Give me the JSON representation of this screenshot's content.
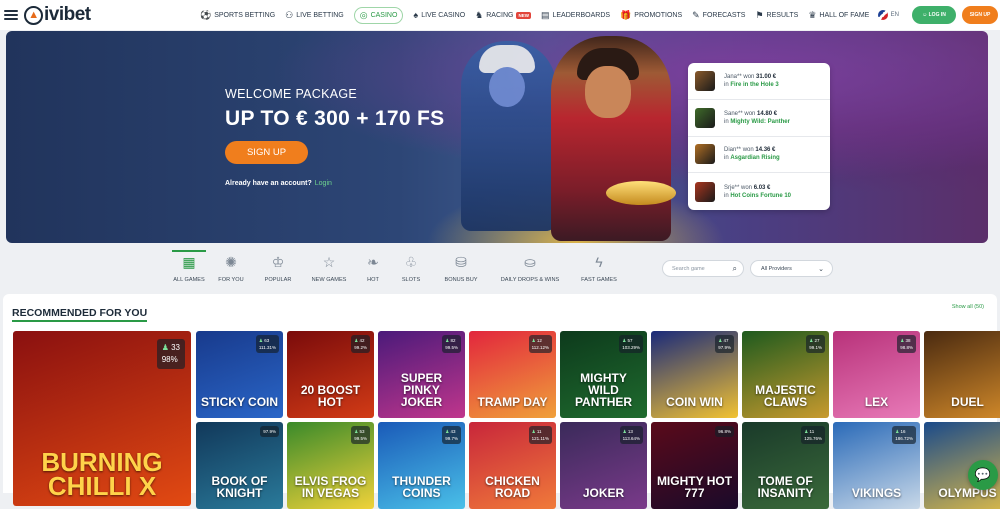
{
  "brand": {
    "name": "ivibet"
  },
  "nav": {
    "items": [
      {
        "label": "SPORTS BETTING",
        "icon": "soccer-ball-icon"
      },
      {
        "label": "LIVE BETTING",
        "icon": "live-icon"
      },
      {
        "label": "CASINO",
        "icon": "casino-chip-icon",
        "active": true
      },
      {
        "label": "LIVE CASINO",
        "icon": "card-icon"
      },
      {
        "label": "RACING",
        "icon": "horse-icon",
        "badge": "NEW"
      },
      {
        "label": "LEADERBOARDS",
        "icon": "leaderboard-icon"
      },
      {
        "label": "PROMOTIONS",
        "icon": "gift-icon"
      },
      {
        "label": "FORECASTS",
        "icon": "forecast-icon"
      },
      {
        "label": "RESULTS",
        "icon": "results-icon"
      },
      {
        "label": "HALL OF FAME",
        "icon": "trophy-icon"
      }
    ],
    "lang": "EN",
    "login_label": "LOG IN",
    "signup_label": "SIGN UP"
  },
  "hero": {
    "subtitle": "WELCOME PACKAGE",
    "headline": "UP TO € 300 + 170 FS",
    "cta": "SIGN UP",
    "account_text": "Already have an account?",
    "login_link": "Login"
  },
  "winners": [
    {
      "name": "Jana**",
      "won_text": "won",
      "amount": "31.00 €",
      "in_text": "in",
      "game": "Fire in the Hole 3",
      "color": "#8a5a2b"
    },
    {
      "name": "Sane**",
      "won_text": "won",
      "amount": "14.80 €",
      "in_text": "in",
      "game": "Mighty Wild: Panther",
      "color": "#3f6b2a"
    },
    {
      "name": "Dian**",
      "won_text": "won",
      "amount": "14.36 €",
      "in_text": "in",
      "game": "Asgardian Rising",
      "color": "#b06f25"
    },
    {
      "name": "Srje**",
      "won_text": "won",
      "amount": "6.03 €",
      "in_text": "in",
      "game": "Hot Coins Fortune 10",
      "color": "#a9361f"
    }
  ],
  "categories": [
    {
      "label": "ALL GAMES",
      "icon": "grid-icon",
      "active": true
    },
    {
      "label": "FOR YOU",
      "icon": "sparkle-icon"
    },
    {
      "label": "POPULAR",
      "icon": "crown-icon"
    },
    {
      "label": "NEW GAMES",
      "icon": "star-icon"
    },
    {
      "label": "HOT",
      "icon": "flame-icon"
    },
    {
      "label": "SLOTS",
      "icon": "cherry-icon"
    },
    {
      "label": "BONUS BUY",
      "icon": "bag-icon"
    },
    {
      "label": "DAILY DROPS & WINS",
      "icon": "drop-icon"
    },
    {
      "label": "FAST GAMES",
      "icon": "lightning-icon"
    }
  ],
  "search": {
    "placeholder": "Search game"
  },
  "providers": {
    "selected": "All Providers"
  },
  "recommended": {
    "title": "RECOMMENDED FOR YOU",
    "show_all": "Show all",
    "show_all_count": "(50)"
  },
  "games": [
    {
      "title": "BURNING CHILLI X",
      "users": "33",
      "rtp": "98%",
      "bg": "#8a1010",
      "bg2": "#e24a12",
      "big": true
    },
    {
      "title": "STICKY COIN",
      "users": "63",
      "rtp": "111.31%",
      "bg": "#183a8c",
      "bg2": "#2a66c8"
    },
    {
      "title": "20 BOOST HOT",
      "users": "42",
      "rtp": "99.2%",
      "bg": "#7a0b0b",
      "bg2": "#d23b16"
    },
    {
      "title": "SUPER PINKY JOKER",
      "users": "82",
      "rtp": "99.5%",
      "bg": "#4b1a7a",
      "bg2": "#c0368c"
    },
    {
      "title": "TRAMP DAY",
      "users": "12",
      "rtp": "112.12%",
      "bg": "#e2263d",
      "bg2": "#f0a03a"
    },
    {
      "title": "MIGHTY WILD PANTHER",
      "users": "57",
      "rtp": "103.29%",
      "bg": "#0d3a1c",
      "bg2": "#1f6b2e"
    },
    {
      "title": "COIN WIN",
      "users": "47",
      "rtp": "97.9%",
      "bg": "#1a2a7a",
      "bg2": "#f2c232"
    },
    {
      "title": "MAJESTIC CLAWS",
      "users": "27",
      "rtp": "99.1%",
      "bg": "#1e5a1e",
      "bg2": "#c89a2e"
    },
    {
      "title": "LEX",
      "users": "38",
      "rtp": "98.8%",
      "bg": "#b8327a",
      "bg2": "#e87ab8"
    },
    {
      "title": "DUEL",
      "users": "",
      "rtp": "",
      "bg": "#4a2a10",
      "bg2": "#d28a2a"
    },
    {
      "title": "BOOK OF KNIGHT",
      "users": "",
      "rtp": "97.9%",
      "bg": "#11385a",
      "bg2": "#2a7a9a"
    },
    {
      "title": "ELVIS FROG IN VEGAS",
      "users": "53",
      "rtp": "99.5%",
      "bg": "#3a8a2a",
      "bg2": "#f0d23a"
    },
    {
      "title": "THUNDER COINS",
      "users": "43",
      "rtp": "99.7%",
      "bg": "#1a5ab8",
      "bg2": "#4ac0e8"
    },
    {
      "title": "CHICKEN ROAD",
      "users": "11",
      "rtp": "121.11%",
      "bg": "#c8263a",
      "bg2": "#f07a3a"
    },
    {
      "title": "JOKER",
      "users": "13",
      "rtp": "113.64%",
      "bg": "#3a2a5a",
      "bg2": "#7a3a8a"
    },
    {
      "title": "MIGHTY HOT 777",
      "users": "",
      "rtp": "96.8%",
      "bg": "#5a0a1a",
      "bg2": "#1a0a2a"
    },
    {
      "title": "TOME OF INSANITY",
      "users": "11",
      "rtp": "125.76%",
      "bg": "#1a3a2a",
      "bg2": "#3a6a3a"
    },
    {
      "title": "VIKINGS",
      "users": "16",
      "rtp": "186.72%",
      "bg": "#2a6ab8",
      "bg2": "#c8d8e8"
    },
    {
      "title": "OLYMPUS",
      "users": "",
      "rtp": "",
      "bg": "#1a4a8a",
      "bg2": "#d8b84a"
    }
  ]
}
